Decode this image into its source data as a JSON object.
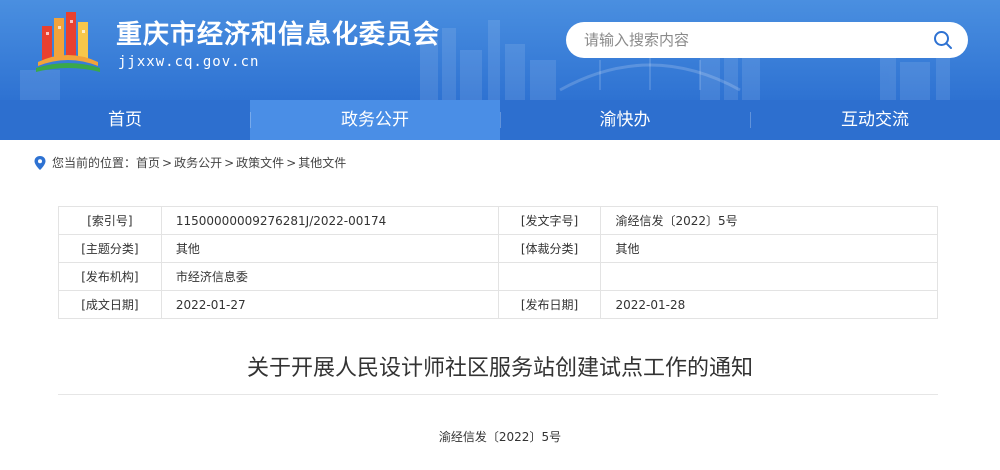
{
  "header": {
    "site_title": "重庆市经济和信息化委员会",
    "site_domain": "jjxxw.cq.gov.cn",
    "logo_icon": "city-skyline-logo-icon"
  },
  "search": {
    "placeholder": "请输入搜索内容",
    "icon": "search-icon"
  },
  "nav": {
    "items": [
      {
        "label": "首页"
      },
      {
        "label": "政务公开"
      },
      {
        "label": "渝快办"
      },
      {
        "label": "互动交流"
      }
    ],
    "active_index": 1
  },
  "breadcrumb": {
    "prefix": "您当前的位置：",
    "items": [
      "首页",
      "政务公开",
      "政策文件",
      "其他文件"
    ],
    "separator": ">"
  },
  "meta": {
    "rows": [
      {
        "k1": "[索引号]",
        "v1": "11500000009276281J/2022-00174",
        "k2": "[发文字号]",
        "v2": "渝经信发〔2022〕5号"
      },
      {
        "k1": "[主题分类]",
        "v1": "其他",
        "k2": "[体裁分类]",
        "v2": "其他"
      },
      {
        "k1": "[发布机构]",
        "v1": "市经济信息委",
        "k2": "",
        "v2": ""
      },
      {
        "k1": "[成文日期]",
        "v1": "2022-01-27",
        "k2": "[发布日期]",
        "v2": "2022-01-28"
      }
    ]
  },
  "document": {
    "title": "关于开展人民设计师社区服务站创建试点工作的通知",
    "number": "渝经信发〔2022〕5号"
  },
  "colors": {
    "header_blue": "#2e72d2",
    "nav_blue": "#2d6fcf",
    "nav_active": "#4a8ee6"
  }
}
